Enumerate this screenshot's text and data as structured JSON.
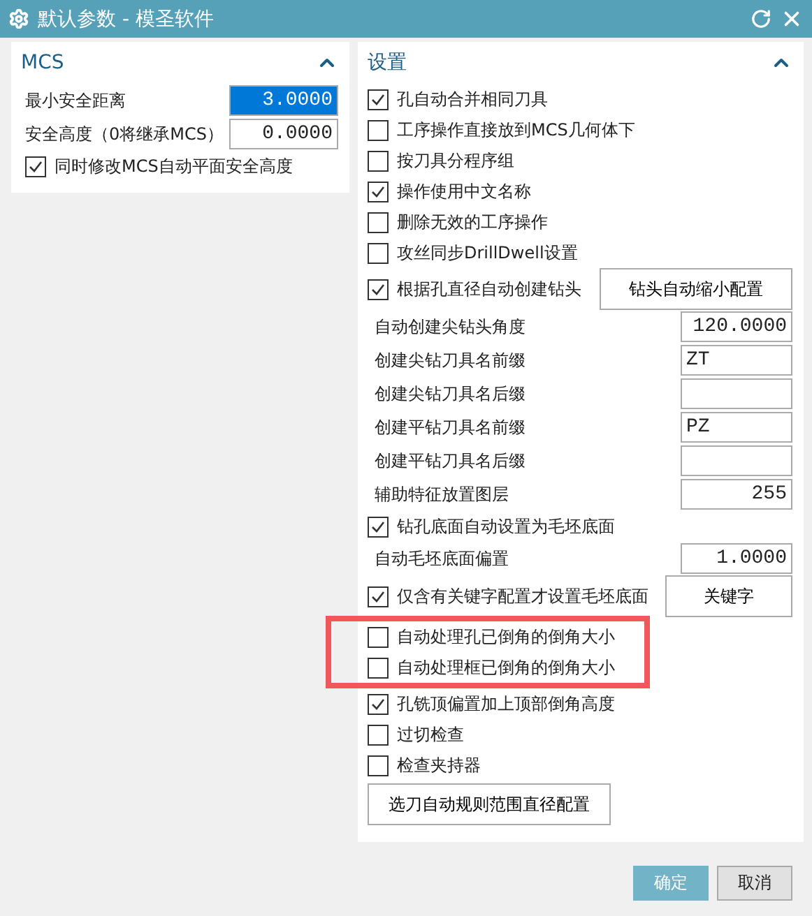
{
  "window": {
    "title": "默认参数 - 模圣软件"
  },
  "mcs": {
    "title": "MCS",
    "expanded": true,
    "fields": [
      {
        "label": "最小安全距离",
        "value": "3.0000",
        "selected": true
      },
      {
        "label": "安全高度（0将继承MCS）",
        "value": "0.0000",
        "selected": false
      }
    ],
    "checkbox": {
      "label": "同时修改MCS自动平面安全高度",
      "checked": true
    }
  },
  "settings": {
    "title": "设置",
    "expanded": true,
    "items": [
      {
        "kind": "check",
        "label": "孔自动合并相同刀具",
        "checked": true,
        "highlighted": false
      },
      {
        "kind": "check",
        "label": "工序操作直接放到MCS几何体下",
        "checked": false,
        "highlighted": false
      },
      {
        "kind": "check",
        "label": "按刀具分程序组",
        "checked": false,
        "highlighted": false
      },
      {
        "kind": "check",
        "label": "操作使用中文名称",
        "checked": true,
        "highlighted": false
      },
      {
        "kind": "check",
        "label": "删除无效的工序操作",
        "checked": false,
        "highlighted": false
      },
      {
        "kind": "check",
        "label": "攻丝同步DrillDwell设置",
        "checked": false,
        "highlighted": false
      },
      {
        "kind": "check",
        "label": "根据孔直径自动创建钻头",
        "checked": true,
        "button": "钻头自动缩小配置",
        "highlighted": false
      },
      {
        "kind": "number",
        "label": "自动创建尖钻头角度",
        "value": "120.0000",
        "highlighted": false
      },
      {
        "kind": "text",
        "label": "创建尖钻刀具名前缀",
        "value": "ZT",
        "highlighted": false
      },
      {
        "kind": "text",
        "label": "创建尖钻刀具名后缀",
        "highlighted": false
      },
      {
        "kind": "text",
        "label": "创建平钻刀具名前缀",
        "value": "PZ",
        "highlighted": false
      },
      {
        "kind": "text",
        "label": "创建平钻刀具名后缀",
        "highlighted": false
      },
      {
        "kind": "number",
        "label": "辅助特征放置图层",
        "value": "255",
        "highlighted": false
      },
      {
        "kind": "check",
        "label": "钻孔底面自动设置为毛坯底面",
        "checked": true,
        "highlighted": false
      },
      {
        "kind": "number",
        "label": "自动毛坯底面偏置",
        "value": "1.0000",
        "highlighted": false
      },
      {
        "kind": "check",
        "label": "仅含有关键字配置才设置毛坯底面",
        "checked": true,
        "button": "关键字",
        "highlighted": false
      },
      {
        "kind": "check",
        "label": "自动处理孔已倒角的倒角大小",
        "checked": false,
        "highlighted": true
      },
      {
        "kind": "check",
        "label": "自动处理框已倒角的倒角大小",
        "checked": false,
        "highlighted": true
      },
      {
        "kind": "check",
        "label": "孔铣顶偏置加上顶部倒角高度",
        "checked": true,
        "highlighted": false
      },
      {
        "kind": "check",
        "label": "过切检查",
        "checked": false,
        "highlighted": false
      },
      {
        "kind": "check",
        "label": "检查夹持器",
        "checked": false,
        "highlighted": false
      },
      {
        "kind": "button",
        "label": "选刀自动规则范围直径配置",
        "highlighted": false
      }
    ]
  },
  "buttons": [
    {
      "label": "确定",
      "kind": "primary"
    },
    {
      "label": "取消",
      "kind": "default"
    }
  ]
}
